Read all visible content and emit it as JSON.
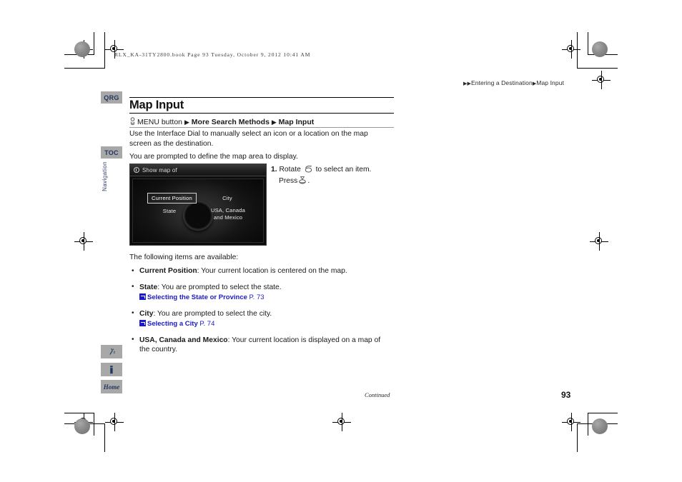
{
  "book_header": "RLX_KA-31TY2800.book  Page 93  Tuesday, October 9, 2012  10:41 AM",
  "breadcrumb": {
    "arrow_double": "▶▶",
    "level1": "Entering a Destination",
    "arrow_single": "▶",
    "level2": "Map Input"
  },
  "sidebar": {
    "tabs": [
      {
        "label": "QRG",
        "name": "quick-reference-guide"
      },
      {
        "label": "TOC",
        "name": "table-of-contents"
      }
    ],
    "section_label": "Navigation",
    "icons": [
      {
        "name": "voice-command-icon",
        "glyph": "♪"
      },
      {
        "name": "info-icon",
        "glyph": "i"
      },
      {
        "name": "home-icon",
        "glyph": "Home"
      }
    ]
  },
  "page": {
    "title": "Map Input",
    "nav_path": {
      "menu_button": "MENU button",
      "step1": "More Search Methods",
      "step2": "Map Input",
      "separator": "▶"
    },
    "intro_paragraph": "Use the Interface Dial to manually select an icon or a location on the map screen as the destination.",
    "prompt_paragraph": "You are prompted to define the map area to display.",
    "items_intro": "The following items are available:"
  },
  "screen": {
    "title": "Show map of",
    "selected_item": "Current Position",
    "items": [
      {
        "label": "Current Position",
        "selected": true
      },
      {
        "label": "State",
        "selected": false
      },
      {
        "label": "City",
        "selected": false
      },
      {
        "label": "USA, Canada and Mexico",
        "selected": false
      }
    ],
    "usa_line1": "USA, Canada",
    "usa_line2": "and Mexico",
    "state_label": "State",
    "city_label": "City"
  },
  "step": {
    "number": "1.",
    "text_before": "Rotate",
    "text_after": "to select an item.",
    "press_before": "Press",
    "press_after": "."
  },
  "bullets": [
    {
      "term": "Current Position",
      "desc": ": Your current location is centered on the map.",
      "xref": null,
      "xref_page": null
    },
    {
      "term": "State",
      "desc": ": You are prompted to select the state.",
      "xref": "Selecting the State or Province",
      "xref_page": "P. 73"
    },
    {
      "term": "City",
      "desc": ": You are prompted to select the city.",
      "xref": "Selecting a City",
      "xref_page": "P. 74"
    },
    {
      "term": "USA, Canada and Mexico",
      "desc": ": Your current location is displayed on a map of the country.",
      "xref": null,
      "xref_page": null
    }
  ],
  "footer": {
    "continued": "Continued",
    "page_number": "93"
  },
  "colors": {
    "tab_background": "#a8a8a8",
    "tab_text": "#21355e",
    "xref_link": "#1a1acc",
    "screen_background": "#0d0d0d"
  }
}
